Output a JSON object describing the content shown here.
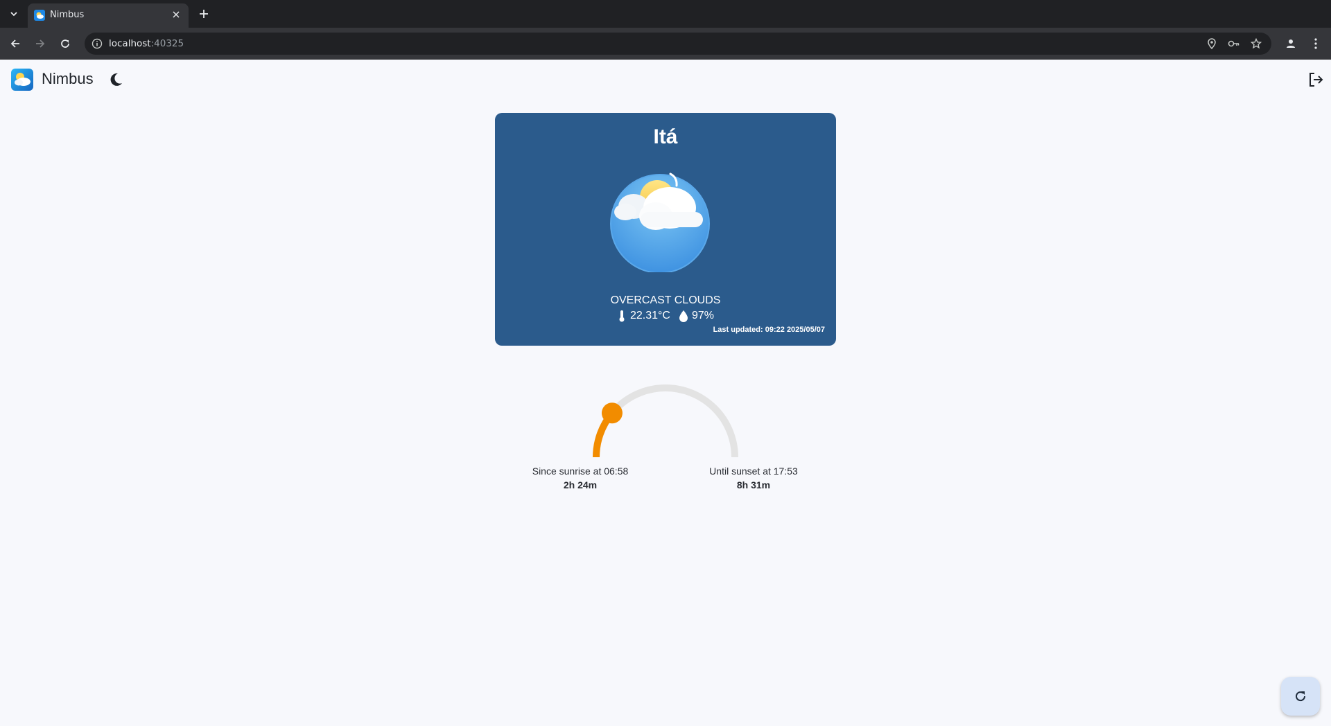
{
  "browser": {
    "tab_title": "Nimbus",
    "url_host": "localhost",
    "url_port": ":40325"
  },
  "app": {
    "title": "Nimbus",
    "icons": {
      "logo": "nimbus-logo-icon",
      "theme_toggle": "moon-icon",
      "logout": "logout-icon",
      "refresh": "refresh-icon"
    }
  },
  "weather": {
    "city": "Itá",
    "condition": "OVERCAST CLOUDS",
    "temperature": "22.31°C",
    "humidity": "97%",
    "last_updated_label": "Last updated:",
    "last_updated_value": "09:22 2025/05/07",
    "card_color": "#2b5b8c"
  },
  "sun": {
    "sunrise_label": "Since sunrise at 06:58",
    "since_sunrise": "2h 24m",
    "sunset_label": "Until sunset at 17:53",
    "until_sunset": "8h 31m",
    "daylight_progress": 0.22,
    "arc_color": "#f28c00",
    "track_color": "#e3e3e3"
  }
}
